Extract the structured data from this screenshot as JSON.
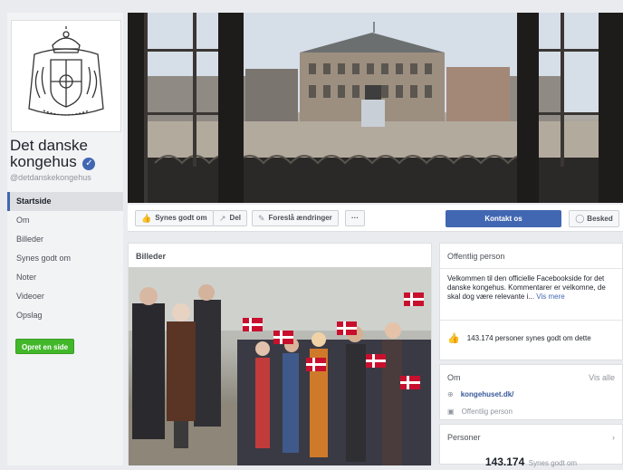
{
  "page": {
    "name_line1": "Det danske",
    "name_line2": "kongehus",
    "verified_glyph": "✓",
    "handle": "@detdanskekongehus"
  },
  "nav": {
    "items": [
      {
        "label": "Startside"
      },
      {
        "label": "Om"
      },
      {
        "label": "Billeder"
      },
      {
        "label": "Synes godt om"
      },
      {
        "label": "Noter"
      },
      {
        "label": "Videoer"
      },
      {
        "label": "Opslag"
      }
    ],
    "create_page": "Opret en side"
  },
  "actions": {
    "like": "Synes godt om",
    "share": "Del",
    "suggest": "Foreslå ændringer",
    "more": "···",
    "contact": "Kontakt os",
    "message": "Besked"
  },
  "photos": {
    "title": "Billeder"
  },
  "sidebar": {
    "category": "Offentlig person",
    "about_text": "Velkommen til den officielle Facebookside for det danske kongehus. Kommentarer er velkomne, de skal dog være relevante i...",
    "about_more": "Vis mere",
    "likes_line": "143.174 personer synes godt om dette",
    "om_title": "Om",
    "see_all": "Vis alle",
    "website": "kongehuset.dk/",
    "category_row": "Offentlig person",
    "people_title": "Personer",
    "people_count": "143.174",
    "people_suffix": "Synes godt om"
  },
  "colors": {
    "brand": "#4267b2",
    "create_green": "#42b72a",
    "background": "#e9ebee"
  }
}
